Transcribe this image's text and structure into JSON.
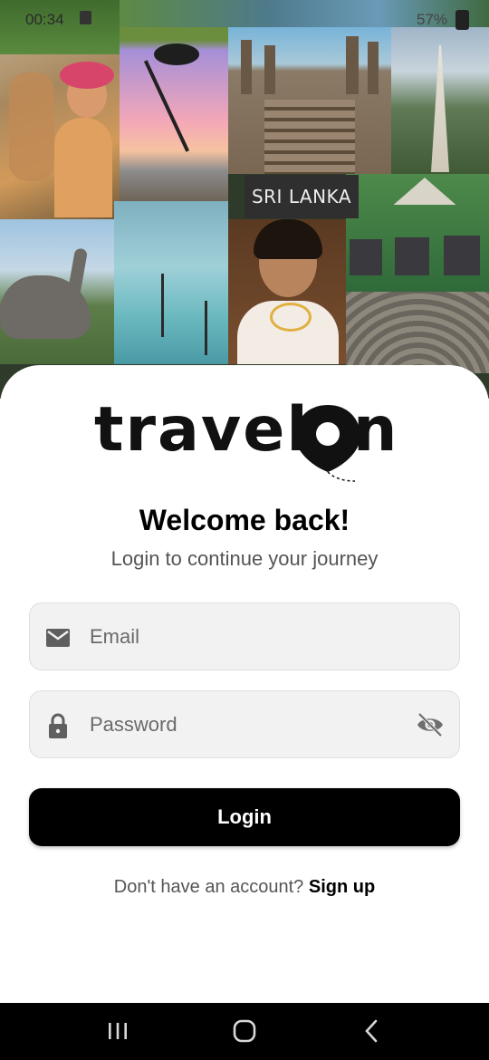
{
  "status_bar": {
    "time": "00:34",
    "battery": "57%"
  },
  "collage": {
    "location_label": "SRI LANKA"
  },
  "brand": {
    "logo_text_left": "travel",
    "logo_text_right": "n"
  },
  "login": {
    "title": "Welcome back!",
    "subtitle": "Login to continue your journey",
    "email_placeholder": "Email",
    "password_placeholder": "Password",
    "button_label": "Login",
    "signup_prompt": "Don't have an account?",
    "signup_link": "Sign up"
  },
  "icons": {
    "email": "mail-icon",
    "password": "lock-icon",
    "toggle": "eye-off-icon"
  },
  "colors": {
    "button": "#000000",
    "field_bg": "#f2f2f2",
    "nav_bar": "#000000"
  }
}
